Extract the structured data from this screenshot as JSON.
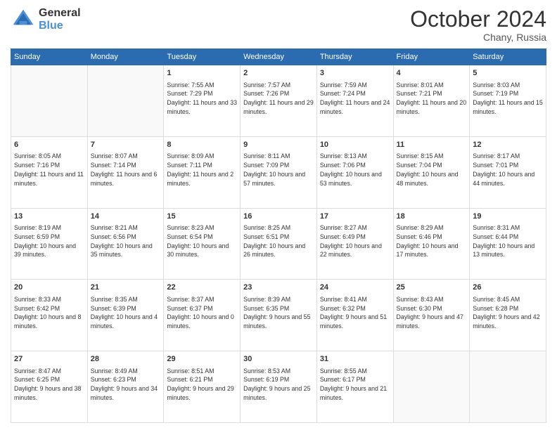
{
  "header": {
    "logo_line1": "General",
    "logo_line2": "Blue",
    "month": "October 2024",
    "location": "Chany, Russia"
  },
  "weekdays": [
    "Sunday",
    "Monday",
    "Tuesday",
    "Wednesday",
    "Thursday",
    "Friday",
    "Saturday"
  ],
  "weeks": [
    [
      {
        "day": "",
        "sunrise": "",
        "sunset": "",
        "daylight": ""
      },
      {
        "day": "",
        "sunrise": "",
        "sunset": "",
        "daylight": ""
      },
      {
        "day": "1",
        "sunrise": "Sunrise: 7:55 AM",
        "sunset": "Sunset: 7:29 PM",
        "daylight": "Daylight: 11 hours and 33 minutes."
      },
      {
        "day": "2",
        "sunrise": "Sunrise: 7:57 AM",
        "sunset": "Sunset: 7:26 PM",
        "daylight": "Daylight: 11 hours and 29 minutes."
      },
      {
        "day": "3",
        "sunrise": "Sunrise: 7:59 AM",
        "sunset": "Sunset: 7:24 PM",
        "daylight": "Daylight: 11 hours and 24 minutes."
      },
      {
        "day": "4",
        "sunrise": "Sunrise: 8:01 AM",
        "sunset": "Sunset: 7:21 PM",
        "daylight": "Daylight: 11 hours and 20 minutes."
      },
      {
        "day": "5",
        "sunrise": "Sunrise: 8:03 AM",
        "sunset": "Sunset: 7:19 PM",
        "daylight": "Daylight: 11 hours and 15 minutes."
      }
    ],
    [
      {
        "day": "6",
        "sunrise": "Sunrise: 8:05 AM",
        "sunset": "Sunset: 7:16 PM",
        "daylight": "Daylight: 11 hours and 11 minutes."
      },
      {
        "day": "7",
        "sunrise": "Sunrise: 8:07 AM",
        "sunset": "Sunset: 7:14 PM",
        "daylight": "Daylight: 11 hours and 6 minutes."
      },
      {
        "day": "8",
        "sunrise": "Sunrise: 8:09 AM",
        "sunset": "Sunset: 7:11 PM",
        "daylight": "Daylight: 11 hours and 2 minutes."
      },
      {
        "day": "9",
        "sunrise": "Sunrise: 8:11 AM",
        "sunset": "Sunset: 7:09 PM",
        "daylight": "Daylight: 10 hours and 57 minutes."
      },
      {
        "day": "10",
        "sunrise": "Sunrise: 8:13 AM",
        "sunset": "Sunset: 7:06 PM",
        "daylight": "Daylight: 10 hours and 53 minutes."
      },
      {
        "day": "11",
        "sunrise": "Sunrise: 8:15 AM",
        "sunset": "Sunset: 7:04 PM",
        "daylight": "Daylight: 10 hours and 48 minutes."
      },
      {
        "day": "12",
        "sunrise": "Sunrise: 8:17 AM",
        "sunset": "Sunset: 7:01 PM",
        "daylight": "Daylight: 10 hours and 44 minutes."
      }
    ],
    [
      {
        "day": "13",
        "sunrise": "Sunrise: 8:19 AM",
        "sunset": "Sunset: 6:59 PM",
        "daylight": "Daylight: 10 hours and 39 minutes."
      },
      {
        "day": "14",
        "sunrise": "Sunrise: 8:21 AM",
        "sunset": "Sunset: 6:56 PM",
        "daylight": "Daylight: 10 hours and 35 minutes."
      },
      {
        "day": "15",
        "sunrise": "Sunrise: 8:23 AM",
        "sunset": "Sunset: 6:54 PM",
        "daylight": "Daylight: 10 hours and 30 minutes."
      },
      {
        "day": "16",
        "sunrise": "Sunrise: 8:25 AM",
        "sunset": "Sunset: 6:51 PM",
        "daylight": "Daylight: 10 hours and 26 minutes."
      },
      {
        "day": "17",
        "sunrise": "Sunrise: 8:27 AM",
        "sunset": "Sunset: 6:49 PM",
        "daylight": "Daylight: 10 hours and 22 minutes."
      },
      {
        "day": "18",
        "sunrise": "Sunrise: 8:29 AM",
        "sunset": "Sunset: 6:46 PM",
        "daylight": "Daylight: 10 hours and 17 minutes."
      },
      {
        "day": "19",
        "sunrise": "Sunrise: 8:31 AM",
        "sunset": "Sunset: 6:44 PM",
        "daylight": "Daylight: 10 hours and 13 minutes."
      }
    ],
    [
      {
        "day": "20",
        "sunrise": "Sunrise: 8:33 AM",
        "sunset": "Sunset: 6:42 PM",
        "daylight": "Daylight: 10 hours and 8 minutes."
      },
      {
        "day": "21",
        "sunrise": "Sunrise: 8:35 AM",
        "sunset": "Sunset: 6:39 PM",
        "daylight": "Daylight: 10 hours and 4 minutes."
      },
      {
        "day": "22",
        "sunrise": "Sunrise: 8:37 AM",
        "sunset": "Sunset: 6:37 PM",
        "daylight": "Daylight: 10 hours and 0 minutes."
      },
      {
        "day": "23",
        "sunrise": "Sunrise: 8:39 AM",
        "sunset": "Sunset: 6:35 PM",
        "daylight": "Daylight: 9 hours and 55 minutes."
      },
      {
        "day": "24",
        "sunrise": "Sunrise: 8:41 AM",
        "sunset": "Sunset: 6:32 PM",
        "daylight": "Daylight: 9 hours and 51 minutes."
      },
      {
        "day": "25",
        "sunrise": "Sunrise: 8:43 AM",
        "sunset": "Sunset: 6:30 PM",
        "daylight": "Daylight: 9 hours and 47 minutes."
      },
      {
        "day": "26",
        "sunrise": "Sunrise: 8:45 AM",
        "sunset": "Sunset: 6:28 PM",
        "daylight": "Daylight: 9 hours and 42 minutes."
      }
    ],
    [
      {
        "day": "27",
        "sunrise": "Sunrise: 8:47 AM",
        "sunset": "Sunset: 6:25 PM",
        "daylight": "Daylight: 9 hours and 38 minutes."
      },
      {
        "day": "28",
        "sunrise": "Sunrise: 8:49 AM",
        "sunset": "Sunset: 6:23 PM",
        "daylight": "Daylight: 9 hours and 34 minutes."
      },
      {
        "day": "29",
        "sunrise": "Sunrise: 8:51 AM",
        "sunset": "Sunset: 6:21 PM",
        "daylight": "Daylight: 9 hours and 29 minutes."
      },
      {
        "day": "30",
        "sunrise": "Sunrise: 8:53 AM",
        "sunset": "Sunset: 6:19 PM",
        "daylight": "Daylight: 9 hours and 25 minutes."
      },
      {
        "day": "31",
        "sunrise": "Sunrise: 8:55 AM",
        "sunset": "Sunset: 6:17 PM",
        "daylight": "Daylight: 9 hours and 21 minutes."
      },
      {
        "day": "",
        "sunrise": "",
        "sunset": "",
        "daylight": ""
      },
      {
        "day": "",
        "sunrise": "",
        "sunset": "",
        "daylight": ""
      }
    ]
  ]
}
